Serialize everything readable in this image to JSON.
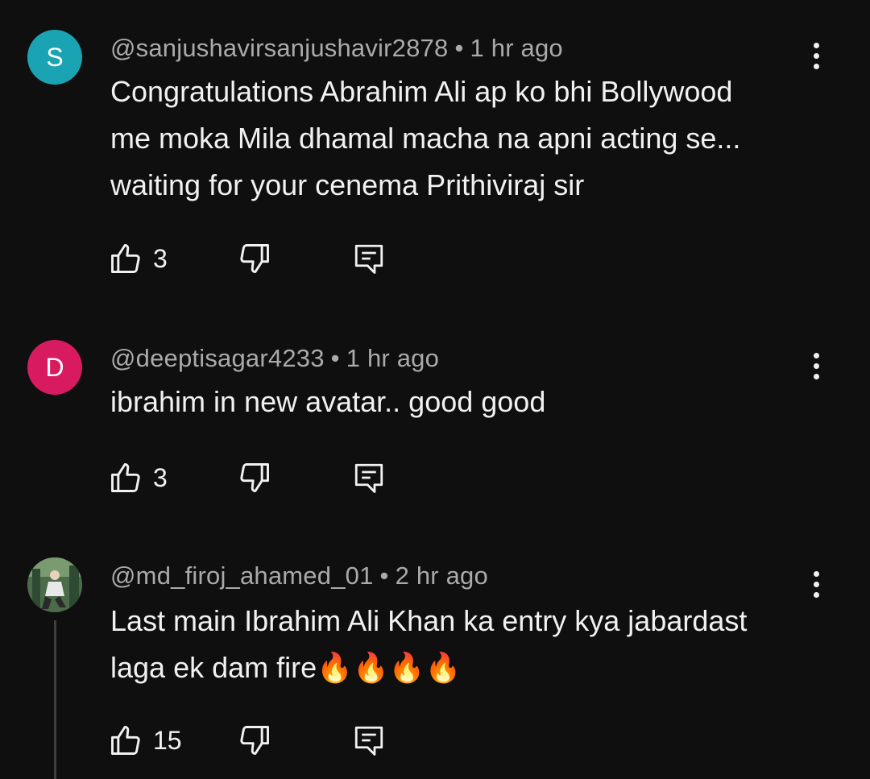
{
  "comments": [
    {
      "avatar_letter": "S",
      "avatar_color": "#1aa3b2",
      "username": "@sanjushavirsanjushavir2878",
      "time": "1 hr ago",
      "text_lines": [
        "Congratulations Abrahim Ali ap ko bhi Bollywood",
        "me moka Mila dhamal macha na apni acting se...",
        "waiting for your cenema Prithiviraj sir"
      ],
      "likes": "3"
    },
    {
      "avatar_letter": "D",
      "avatar_color": "#d81b60",
      "username": "@deeptisagar4233",
      "time": "1 hr ago",
      "text_lines": [
        "ibrahim in new avatar.. good good"
      ],
      "likes": "3"
    },
    {
      "avatar_letter": "",
      "avatar_color": "#3d5a40",
      "username": "@md_firoj_ahamed_01",
      "time": "2 hr ago",
      "text_lines": [
        "Last main Ibrahim Ali Khan ka entry kya jabardast",
        "laga ek dam fire🔥🔥🔥🔥"
      ],
      "likes": "15"
    }
  ],
  "icons": {
    "like": "thumbs-up-icon",
    "dislike": "thumbs-down-icon",
    "reply": "reply-comment-icon",
    "more": "more-vertical-icon"
  },
  "separator": "•"
}
